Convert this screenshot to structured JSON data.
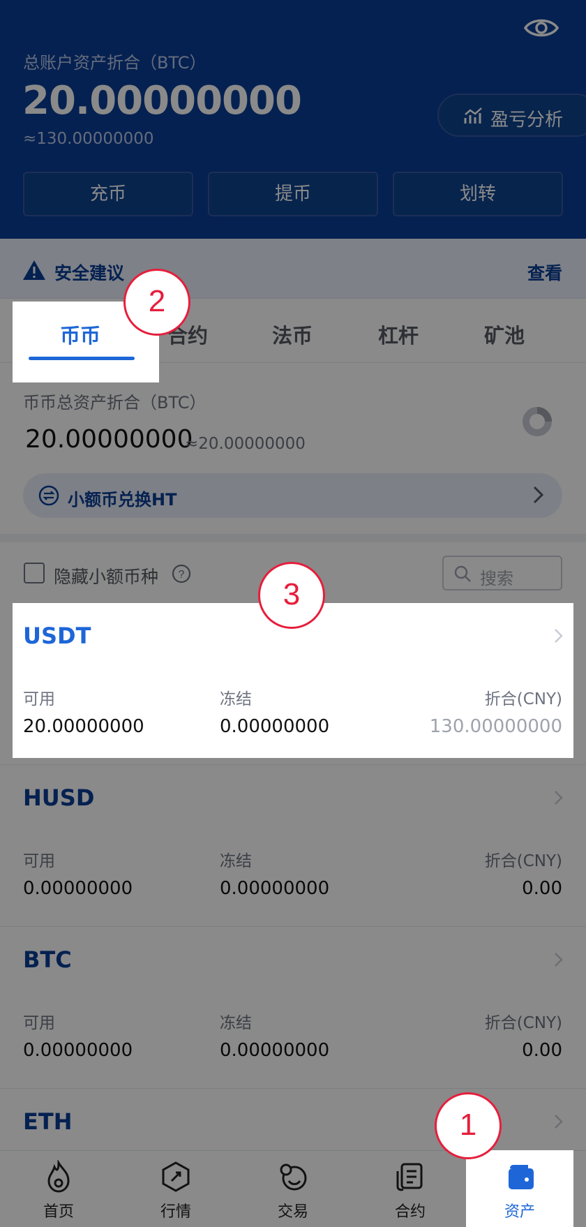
{
  "header": {
    "total_label": "总账户资产折合（BTC）",
    "total_value": "20.00000000",
    "total_approx": "≈130.00000000",
    "pnl_label": "盈亏分析",
    "buttons": [
      "充币",
      "提币",
      "划转"
    ]
  },
  "alert": {
    "label": "安全建议",
    "link": "查看"
  },
  "tabs": [
    "币币",
    "合约",
    "法币",
    "杠杆",
    "矿池"
  ],
  "spot": {
    "label": "币币总资产折合（BTC）",
    "value": "20.00000000",
    "approx": "≈20.00000000",
    "convert_label": "小额币兑换HT"
  },
  "filter": {
    "hide_label": "隐藏小额币种",
    "search_placeholder": "搜索"
  },
  "columns": {
    "available": "可用",
    "frozen": "冻结",
    "cny": "折合(CNY)"
  },
  "coins": [
    {
      "name": "USDT",
      "available": "20.00000000",
      "frozen": "0.00000000",
      "cny": "130.00000000"
    },
    {
      "name": "HUSD",
      "available": "0.00000000",
      "frozen": "0.00000000",
      "cny": "0.00"
    },
    {
      "name": "BTC",
      "available": "0.00000000",
      "frozen": "0.00000000",
      "cny": "0.00"
    },
    {
      "name": "ETH"
    }
  ],
  "nav": [
    "首页",
    "行情",
    "交易",
    "合约",
    "资产"
  ],
  "badges": [
    "1",
    "2",
    "3"
  ],
  "colors": {
    "header_bg": "#0a3d96",
    "accent": "#1e66d8",
    "badge": "#e61e3c"
  }
}
